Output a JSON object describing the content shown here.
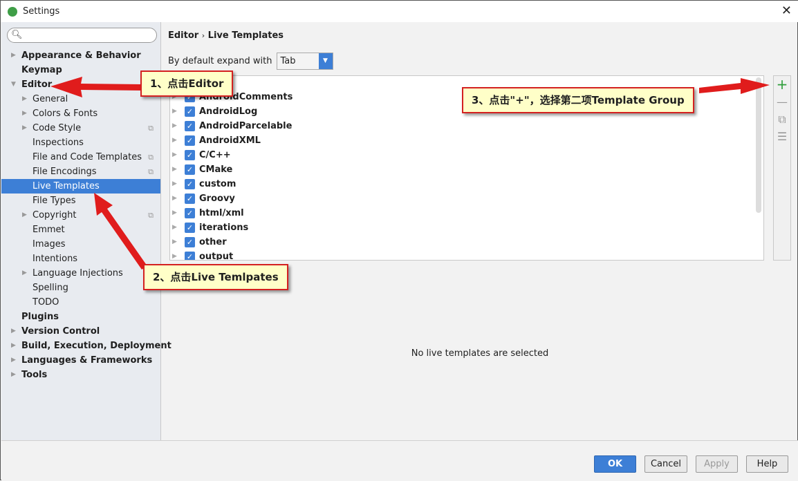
{
  "window": {
    "title": "Settings",
    "close_icon": "close-icon"
  },
  "search": {
    "placeholder": ""
  },
  "sidebar": {
    "items": [
      {
        "label": "Appearance & Behavior",
        "level": 0,
        "bold": true,
        "arrow": "right"
      },
      {
        "label": "Keymap",
        "level": 0,
        "bold": true,
        "arrow": ""
      },
      {
        "label": "Editor",
        "level": 0,
        "bold": true,
        "arrow": "down"
      },
      {
        "label": "General",
        "level": 1,
        "arrow": "right"
      },
      {
        "label": "Colors & Fonts",
        "level": 1,
        "arrow": "right"
      },
      {
        "label": "Code Style",
        "level": 1,
        "arrow": "right",
        "copy": true
      },
      {
        "label": "Inspections",
        "level": 1,
        "arrow": ""
      },
      {
        "label": "File and Code Templates",
        "level": 1,
        "arrow": "",
        "copy": true
      },
      {
        "label": "File Encodings",
        "level": 1,
        "arrow": "",
        "copy": true
      },
      {
        "label": "Live Templates",
        "level": 1,
        "arrow": "",
        "selected": true
      },
      {
        "label": "File Types",
        "level": 1,
        "arrow": ""
      },
      {
        "label": "Copyright",
        "level": 1,
        "arrow": "right",
        "copy": true
      },
      {
        "label": "Emmet",
        "level": 1,
        "arrow": ""
      },
      {
        "label": "Images",
        "level": 1,
        "arrow": ""
      },
      {
        "label": "Intentions",
        "level": 1,
        "arrow": ""
      },
      {
        "label": "Language Injections",
        "level": 1,
        "arrow": "right"
      },
      {
        "label": "Spelling",
        "level": 1,
        "arrow": ""
      },
      {
        "label": "TODO",
        "level": 1,
        "arrow": ""
      },
      {
        "label": "Plugins",
        "level": 0,
        "bold": true,
        "arrow": ""
      },
      {
        "label": "Version Control",
        "level": 0,
        "bold": true,
        "arrow": "right"
      },
      {
        "label": "Build, Execution, Deployment",
        "level": 0,
        "bold": true,
        "arrow": "right"
      },
      {
        "label": "Languages & Frameworks",
        "level": 0,
        "bold": true,
        "arrow": "right"
      },
      {
        "label": "Tools",
        "level": 0,
        "bold": true,
        "arrow": "right"
      }
    ]
  },
  "main": {
    "breadcrumb": {
      "parent": "Editor",
      "sep": "›",
      "current": "Live Templates"
    },
    "expand_label": "By default expand with",
    "expand_value": "Tab",
    "templates": [
      "AndroidComments",
      "AndroidLog",
      "AndroidParcelable",
      "AndroidXML",
      "C/C++",
      "CMake",
      "custom",
      "Groovy",
      "html/xml",
      "iterations",
      "other",
      "output"
    ],
    "empty_text": "No live templates are selected"
  },
  "toolbar": {
    "icons": [
      "plus-icon",
      "minus-icon",
      "copy-icon",
      "list-icon"
    ],
    "plus_color": "#2e9e3a"
  },
  "footer": {
    "ok": "OK",
    "cancel": "Cancel",
    "apply": "Apply",
    "help": "Help"
  },
  "annotations": {
    "step1": "1、点击Editor",
    "step2": "2、点击Live Temlpates",
    "step3": "3、点击\"+\"，选择第二项Template Group",
    "color": "#d42020"
  }
}
